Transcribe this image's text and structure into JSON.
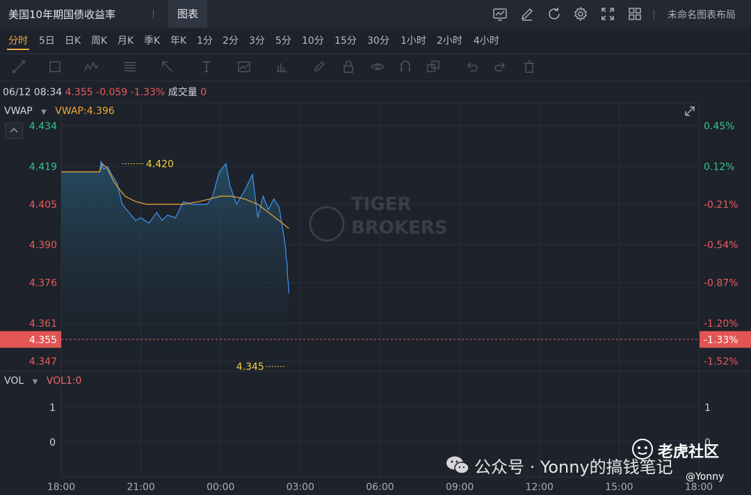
{
  "header": {
    "title": "美国10年期国债收益率",
    "tab_chart": "图表",
    "layout_name": "未命名图表布局"
  },
  "periods": [
    "分时",
    "5日",
    "日K",
    "周K",
    "月K",
    "季K",
    "年K",
    "1分",
    "2分",
    "3分",
    "5分",
    "10分",
    "15分",
    "30分",
    "1小时",
    "2小时",
    "4小时"
  ],
  "active_period": "分时",
  "info": {
    "datetime": "06/12 08:34",
    "price": "4.355",
    "change": "-0.059",
    "change_pct": "-1.33%",
    "volume_label": "成交量",
    "volume_value": "0"
  },
  "indicator": {
    "name": "VWAP",
    "value_label": "VWAP:4.396"
  },
  "volume_panel": {
    "name": "VOL",
    "value_label": "VOL1:0",
    "y_ticks": [
      "1",
      "0"
    ]
  },
  "watermark": {
    "brand": "老虎社区",
    "account": "公众号 · Yonny的搞钱笔记",
    "user": "@Yonny"
  },
  "colors": {
    "price_line": "#3d8fe8",
    "vwap_line": "#e1a235",
    "up": "#35c48a",
    "down": "#ee5a5a",
    "marker": "#f3d23a"
  },
  "chart_data": {
    "type": "line",
    "x_ticks": [
      "18:00",
      "21:00",
      "00:00",
      "03:00",
      "06:00",
      "09:00",
      "12:00",
      "15:00",
      "18:00"
    ],
    "y_ticks_left": [
      "4.434",
      "4.419",
      "4.405",
      "4.390",
      "4.376",
      "4.361",
      "4.347"
    ],
    "y_ticks_right": [
      "0.45%",
      "0.12%",
      "-0.21%",
      "-0.54%",
      "-0.87%",
      "-1.20%",
      "-1.52%"
    ],
    "ylim": [
      4.3435,
      4.4425
    ],
    "current_price": "4.355",
    "current_pct": "-1.33%",
    "annotations": [
      {
        "label": "4.420",
        "time": 2.3,
        "value": 4.42
      },
      {
        "label": "4.345",
        "time": 8.45,
        "value": 4.345
      }
    ],
    "series": [
      {
        "name": "price",
        "t": [
          0,
          1.45,
          1.5,
          1.6,
          1.75,
          1.9,
          2.1,
          2.3,
          2.55,
          2.8,
          3.0,
          3.3,
          3.6,
          3.8,
          4.0,
          4.3,
          4.6,
          4.9,
          5.2,
          5.5,
          5.7,
          5.95,
          6.2,
          6.35,
          6.6,
          6.9,
          7.2,
          7.4,
          7.6,
          7.8,
          8.0,
          8.2,
          8.4,
          8.45,
          8.47,
          8.5,
          8.52,
          8.55,
          8.57
        ],
        "v": [
          4.417,
          4.417,
          4.421,
          4.418,
          4.419,
          4.416,
          4.413,
          4.405,
          4.402,
          4.399,
          4.4,
          4.398,
          4.402,
          4.399,
          4.401,
          4.4,
          4.406,
          4.405,
          4.405,
          4.405,
          4.408,
          4.417,
          4.42,
          4.412,
          4.405,
          4.41,
          4.416,
          4.4,
          4.408,
          4.403,
          4.407,
          4.404,
          4.392,
          4.388,
          4.385,
          4.383,
          4.378,
          4.376,
          4.372,
          4.368,
          4.369,
          4.345,
          4.355
        ]
      },
      {
        "name": "vwap",
        "t": [
          0,
          1.45,
          1.55,
          1.75,
          2.0,
          2.4,
          2.8,
          3.2,
          3.6,
          4.0,
          4.6,
          5.2,
          5.6,
          6.0,
          6.4,
          6.9,
          7.4,
          7.8,
          8.2,
          8.57
        ],
        "v": [
          4.417,
          4.417,
          4.42,
          4.418,
          4.413,
          4.408,
          4.406,
          4.405,
          4.405,
          4.405,
          4.405,
          4.406,
          4.407,
          4.408,
          4.408,
          4.407,
          4.405,
          4.402,
          4.399,
          4.396
        ]
      }
    ]
  }
}
